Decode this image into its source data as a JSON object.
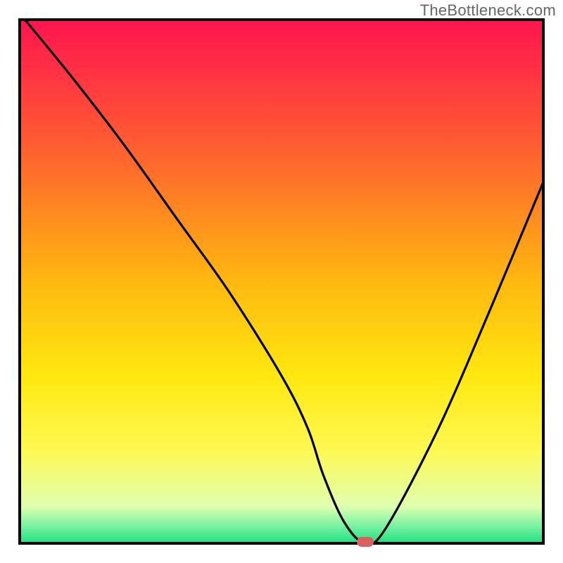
{
  "watermark": "TheBottleneck.com",
  "chart_data": {
    "type": "line",
    "title": "",
    "xlabel": "",
    "ylabel": "",
    "xlim": [
      0,
      100
    ],
    "ylim": [
      0,
      100
    ],
    "x": [
      1,
      10,
      20,
      30,
      40,
      50,
      55,
      58,
      62,
      66,
      70,
      80,
      90,
      100
    ],
    "values": [
      100,
      89,
      76,
      62,
      48,
      32,
      22,
      13,
      4,
      0,
      3,
      22,
      45,
      69
    ],
    "optimum_x": 66,
    "watermark": "TheBottleneck.com",
    "background": {
      "type": "vertical-gradient",
      "stops": [
        {
          "offset": 0.0,
          "color": "#ff1450"
        },
        {
          "offset": 0.25,
          "color": "#ff6030"
        },
        {
          "offset": 0.5,
          "color": "#ffb810"
        },
        {
          "offset": 0.68,
          "color": "#ffe810"
        },
        {
          "offset": 0.82,
          "color": "#fff850"
        },
        {
          "offset": 0.93,
          "color": "#e0ffb0"
        },
        {
          "offset": 0.97,
          "color": "#70f0a0"
        },
        {
          "offset": 1.0,
          "color": "#20e080"
        }
      ]
    },
    "marker": {
      "x": 66,
      "y": 0,
      "color": "#d86060"
    }
  }
}
